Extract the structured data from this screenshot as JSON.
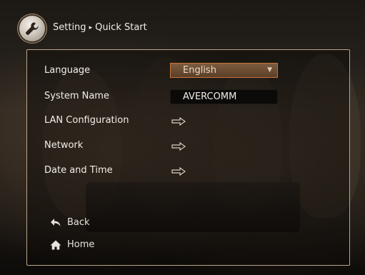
{
  "breadcrumb": {
    "section": "Setting",
    "page": "Quick Start",
    "separator": "▸"
  },
  "form": {
    "language_label": "Language",
    "language_value": "English",
    "system_name_label": "System Name",
    "system_name_value": "AVERCOMM",
    "lan_label": "LAN Configuration",
    "network_label": "Network",
    "datetime_label": "Date and Time"
  },
  "nav": {
    "back_label": "Back",
    "home_label": "Home"
  },
  "icons": {
    "settings": "wrench-icon",
    "dropdown": "chevron-down-icon",
    "enter": "arrow-right-icon",
    "back": "undo-arrow-icon",
    "home": "home-icon"
  },
  "colors": {
    "panel_border": "#b9a48a",
    "select_bg": "#6e4e33",
    "select_border": "#c7733a"
  }
}
